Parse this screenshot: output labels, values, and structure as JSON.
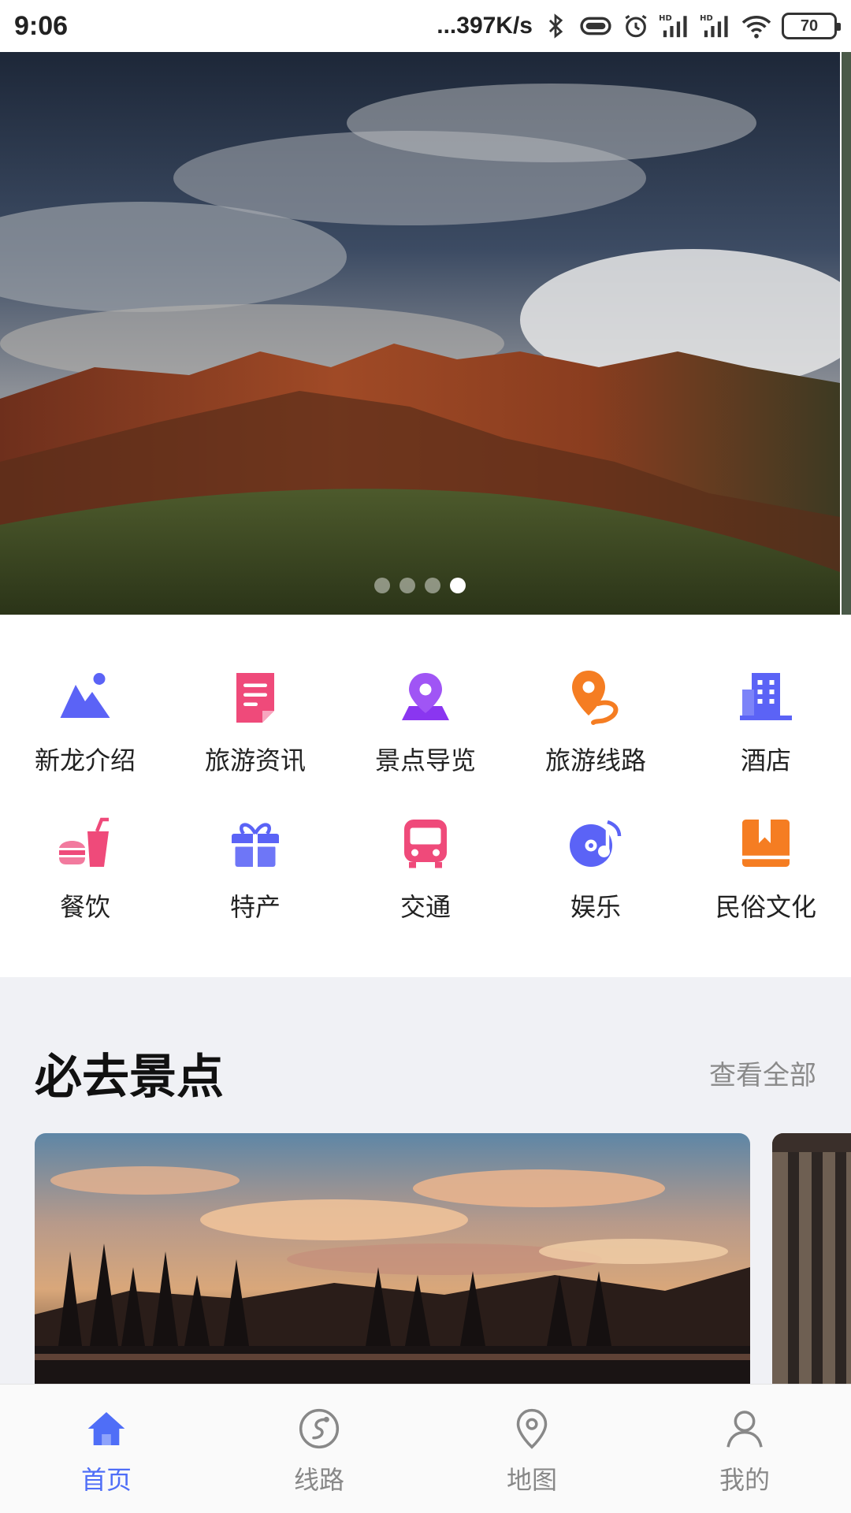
{
  "status_bar": {
    "time": "9:06",
    "net_speed": "...397K/s",
    "battery": "70",
    "icons": [
      "bluetooth-icon",
      "vibrate-icon",
      "alarm-icon",
      "hd-signal-icon",
      "hd-signal-icon",
      "wifi-icon",
      "battery-icon"
    ]
  },
  "banner": {
    "slides": 4,
    "active_slide": 4
  },
  "categories": [
    {
      "label": "新龙介绍",
      "icon": "mountain-icon",
      "color": "#5b63f6"
    },
    {
      "label": "旅游资讯",
      "icon": "document-icon",
      "color": "#ef4a7a"
    },
    {
      "label": "景点导览",
      "icon": "location-pin-icon",
      "color": "#8a36f0"
    },
    {
      "label": "旅游线路",
      "icon": "route-icon",
      "color": "#f57d22"
    },
    {
      "label": "酒店",
      "icon": "building-icon",
      "color": "#5b63f6"
    },
    {
      "label": "餐饮",
      "icon": "fast-food-icon",
      "color": "#ef4a7a"
    },
    {
      "label": "特产",
      "icon": "gift-icon",
      "color": "#5b63f6"
    },
    {
      "label": "交通",
      "icon": "bus-icon",
      "color": "#ef4a7a"
    },
    {
      "label": "娱乐",
      "icon": "music-disc-icon",
      "color": "#5b63f6"
    },
    {
      "label": "民俗文化",
      "icon": "book-icon",
      "color": "#f57d22"
    }
  ],
  "must_visit": {
    "title": "必去景点",
    "more": "查看全部"
  },
  "tabs": [
    {
      "label": "首页",
      "icon": "home-icon",
      "active": true
    },
    {
      "label": "线路",
      "icon": "route-circle-icon",
      "active": false
    },
    {
      "label": "地图",
      "icon": "map-pin-icon",
      "active": false
    },
    {
      "label": "我的",
      "icon": "user-icon",
      "active": false
    }
  ],
  "colors": {
    "accent": "#4f6ef7",
    "section_bg": "#f0f1f5"
  }
}
